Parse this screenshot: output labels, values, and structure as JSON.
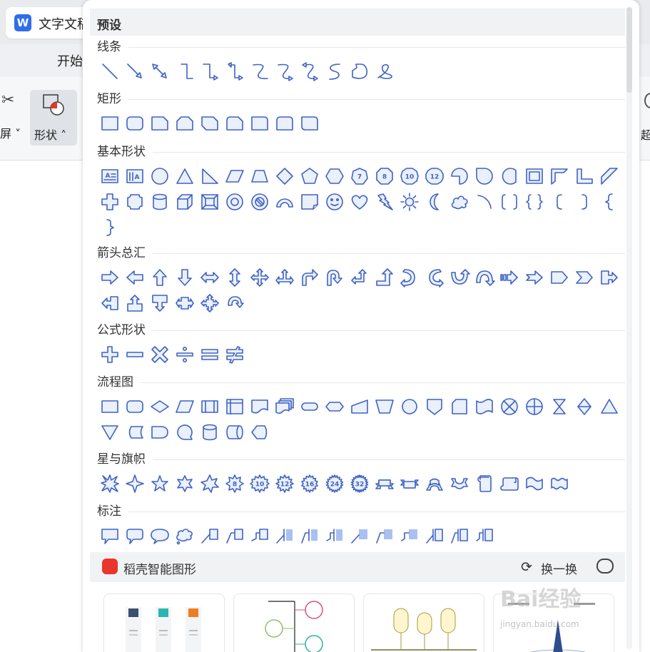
{
  "app": {
    "doc_tab_title": "文字文稿",
    "logo_letter": "W",
    "menu_start": "开始",
    "ribbon": {
      "screen_label": "屏 ˅",
      "shape_label": "形状 ˄",
      "right_cut_label": "超"
    }
  },
  "panel": {
    "preset_title": "预设",
    "sections": [
      {
        "id": "lines",
        "title": "线条",
        "icons": [
          "line-icon",
          "arrow-line-icon",
          "double-arrow-line-icon",
          "elbow-connector-icon",
          "elbow-arrow-connector-icon",
          "elbow-double-arrow-connector-icon",
          "curved-connector-icon",
          "curved-arrow-connector-icon",
          "curved-double-arrow-connector-icon",
          "curve-icon",
          "freeform-icon",
          "scribble-icon"
        ]
      },
      {
        "id": "rectangles",
        "title": "矩形",
        "icons": [
          "rectangle-icon",
          "rounded-rectangle-icon",
          "snip-single-corner-rectangle-icon",
          "snip-same-side-rectangle-icon",
          "snip-diagonal-rectangle-icon",
          "snip-round-rectangle-icon",
          "round-single-corner-rectangle-icon",
          "round-same-side-rectangle-icon",
          "round-diagonal-rectangle-icon"
        ]
      },
      {
        "id": "basic",
        "title": "基本形状",
        "icons": [
          "text-box-icon",
          "vertical-text-box-icon",
          "oval-icon",
          "triangle-icon",
          "right-triangle-icon",
          "parallelogram-icon",
          "trapezoid-icon",
          "diamond-icon",
          "pentagon-icon",
          "hexagon-icon",
          "heptagon-icon",
          "octagon-icon",
          "decagon-icon",
          "dodecagon-icon",
          "pie-icon",
          "teardrop-icon",
          "chord-icon",
          "frame-icon",
          "half-frame-icon",
          "l-shape-icon",
          "diagonal-stripe-icon",
          "plus-icon",
          "plaque-icon",
          "can-icon",
          "cube-icon",
          "bevel-icon",
          "donut-icon",
          "no-symbol-icon",
          "block-arc-icon",
          "folded-corner-icon",
          "smiley-face-icon",
          "heart-icon",
          "lightning-bolt-icon",
          "sun-icon",
          "moon-icon",
          "cloud-icon",
          "arc-icon",
          "double-bracket-icon",
          "double-brace-icon",
          "left-bracket-icon",
          "right-bracket-icon",
          "left-brace-icon",
          "right-brace-icon"
        ],
        "badges": {
          "heptagon-icon": "7",
          "octagon-icon": "8",
          "decagon-icon": "10",
          "dodecagon-icon": "12"
        }
      },
      {
        "id": "arrows",
        "title": "箭头总汇",
        "icons": [
          "right-arrow-icon",
          "left-arrow-icon",
          "up-arrow-icon",
          "down-arrow-icon",
          "left-right-arrow-icon",
          "up-down-arrow-icon",
          "quad-arrow-icon",
          "left-right-up-arrow-icon",
          "bent-arrow-icon",
          "u-turn-arrow-icon",
          "left-up-arrow-icon",
          "bent-up-arrow-icon",
          "curved-right-arrow-icon",
          "curved-left-arrow-icon",
          "curved-up-arrow-icon",
          "curved-down-arrow-icon",
          "striped-right-arrow-icon",
          "notched-right-arrow-icon",
          "pentagon-arrow-icon",
          "chevron-icon",
          "right-arrow-callout-icon",
          "left-arrow-callout-icon",
          "up-arrow-callout-icon",
          "down-arrow-callout-icon",
          "left-right-arrow-callout-icon",
          "quad-arrow-callout-icon",
          "circular-arrow-icon"
        ]
      },
      {
        "id": "equation",
        "title": "公式形状",
        "icons": [
          "plus-sign-icon",
          "minus-sign-icon",
          "multiply-sign-icon",
          "division-sign-icon",
          "equal-sign-icon",
          "not-equal-sign-icon"
        ]
      },
      {
        "id": "flowchart",
        "title": "流程图",
        "icons": [
          "flowchart-process-icon",
          "flowchart-alternate-process-icon",
          "flowchart-decision-icon",
          "flowchart-data-icon",
          "flowchart-predefined-process-icon",
          "flowchart-internal-storage-icon",
          "flowchart-document-icon",
          "flowchart-multidocument-icon",
          "flowchart-terminator-icon",
          "flowchart-preparation-icon",
          "flowchart-manual-input-icon",
          "flowchart-manual-operation-icon",
          "flowchart-connector-icon",
          "flowchart-off-page-connector-icon",
          "flowchart-card-icon",
          "flowchart-punched-tape-icon",
          "flowchart-summing-junction-icon",
          "flowchart-or-icon",
          "flowchart-collate-icon",
          "flowchart-sort-icon",
          "flowchart-extract-icon",
          "flowchart-merge-icon",
          "flowchart-stored-data-icon",
          "flowchart-delay-icon",
          "flowchart-sequential-access-icon",
          "flowchart-magnetic-disk-icon",
          "flowchart-direct-access-icon",
          "flowchart-display-icon"
        ]
      },
      {
        "id": "stars",
        "title": "星与旗帜",
        "icons": [
          "explosion-icon",
          "star-4-icon",
          "star-5-icon",
          "star-6-icon",
          "star-7-icon",
          "star-8-icon",
          "star-10-icon",
          "star-12-icon",
          "star-16-icon",
          "star-24-icon",
          "star-32-icon",
          "ribbon-up-icon",
          "ribbon-down-icon",
          "curved-ribbon-up-icon",
          "curved-ribbon-down-icon",
          "vertical-scroll-icon",
          "horizontal-scroll-icon",
          "wave-icon",
          "double-wave-icon"
        ],
        "badges": {
          "star-8-icon": "8",
          "star-10-icon": "10",
          "star-12-icon": "12",
          "star-16-icon": "16",
          "star-24-icon": "24",
          "star-32-icon": "32"
        }
      },
      {
        "id": "callouts",
        "title": "标注",
        "icons": [
          "rectangular-callout-icon",
          "rounded-rectangular-callout-icon",
          "oval-callout-icon",
          "cloud-callout-icon",
          "line-callout-1-icon",
          "line-callout-2-icon",
          "line-callout-3-icon",
          "line-callout-accent-1-icon",
          "line-callout-accent-2-icon",
          "line-callout-accent-3-icon",
          "line-callout-border-1-icon",
          "line-callout-border-2-icon",
          "line-callout-border-3-icon",
          "line-callout-accent-border-1-icon",
          "line-callout-accent-border-2-icon",
          "line-callout-accent-border-3-icon"
        ]
      }
    ],
    "smart": {
      "title": "稻壳智能图形",
      "swap_label": "换一换",
      "swap_icon": "refresh-icon",
      "comment_icon": "comment-icon"
    },
    "watermark": {
      "text": "Bai经验",
      "sub": "jingyan.baidu.com"
    }
  },
  "colors": {
    "shape_stroke": "#3f63c4",
    "shape_fill": "#eaf0fc",
    "accent_red": "#e8362d",
    "brand_blue": "#2f6ee8"
  }
}
